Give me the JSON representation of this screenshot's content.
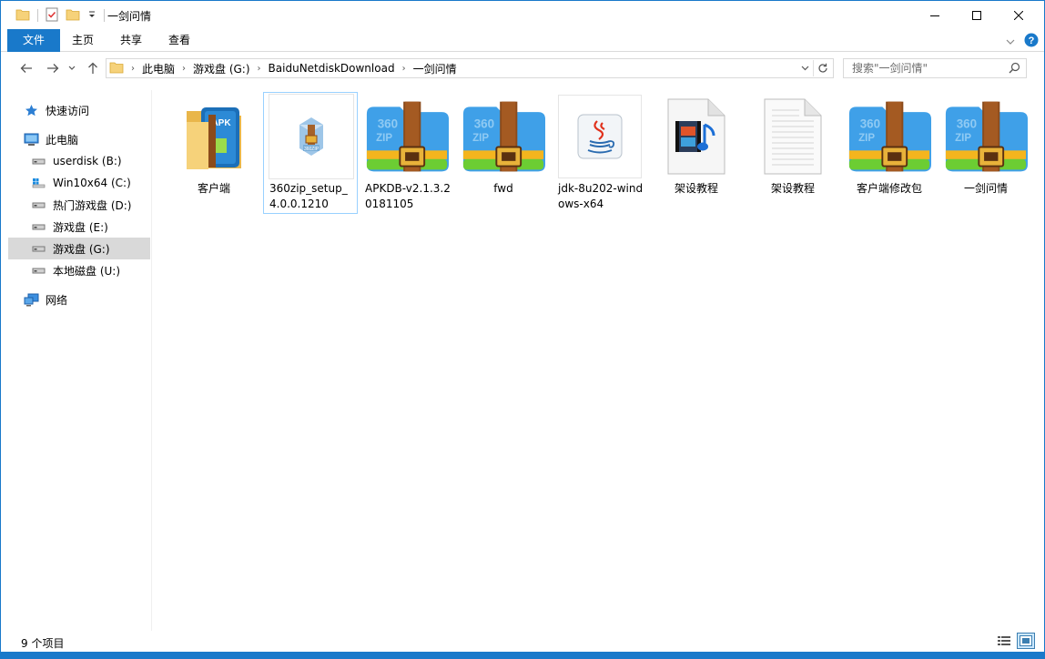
{
  "window": {
    "title": "一剑问情"
  },
  "ribbon": {
    "tabs": [
      "文件",
      "主页",
      "共享",
      "查看"
    ]
  },
  "address": {
    "crumbs": [
      "此电脑",
      "游戏盘 (G:)",
      "BaiduNetdiskDownload",
      "一剑问情"
    ]
  },
  "search": {
    "placeholder": "搜索\"一剑问情\""
  },
  "nav": {
    "quick_access": "快速访问",
    "this_pc": "此电脑",
    "drives": [
      {
        "label": "userdisk (B:)",
        "icon": "drive-icon"
      },
      {
        "label": "Win10x64 (C:)",
        "icon": "windows-drive-icon"
      },
      {
        "label": "热门游戏盘 (D:)",
        "icon": "drive-icon"
      },
      {
        "label": "游戏盘 (E:)",
        "icon": "drive-icon"
      },
      {
        "label": "游戏盘 (G:)",
        "icon": "drive-icon",
        "selected": true
      },
      {
        "label": "本地磁盘 (U:)",
        "icon": "drive-icon"
      }
    ],
    "network": "网络"
  },
  "files": [
    {
      "name": "客户端",
      "type": "folder",
      "icon": "apk-folder-icon"
    },
    {
      "name": "360zip_setup_4.0.0.1210",
      "type": "installer",
      "icon": "installer-icon",
      "selected": true
    },
    {
      "name": "APKDB-v2.1.3.20181105",
      "type": "archive",
      "icon": "360zip-archive-icon"
    },
    {
      "name": "fwd",
      "type": "archive",
      "icon": "360zip-archive-icon"
    },
    {
      "name": "jdk-8u202-windows-x64",
      "type": "executable",
      "icon": "java-icon"
    },
    {
      "name": "架设教程",
      "type": "video",
      "icon": "video-file-icon"
    },
    {
      "name": "架设教程",
      "type": "text",
      "icon": "text-file-icon"
    },
    {
      "name": "客户端修改包",
      "type": "archive",
      "icon": "360zip-archive-icon"
    },
    {
      "name": "一剑问情",
      "type": "archive",
      "icon": "360zip-archive-icon"
    }
  ],
  "status": {
    "count": "9 个项目"
  },
  "colors": {
    "accent": "#1979ca",
    "selection": "#cce8ff",
    "nav_selected": "#d9d9d9"
  }
}
